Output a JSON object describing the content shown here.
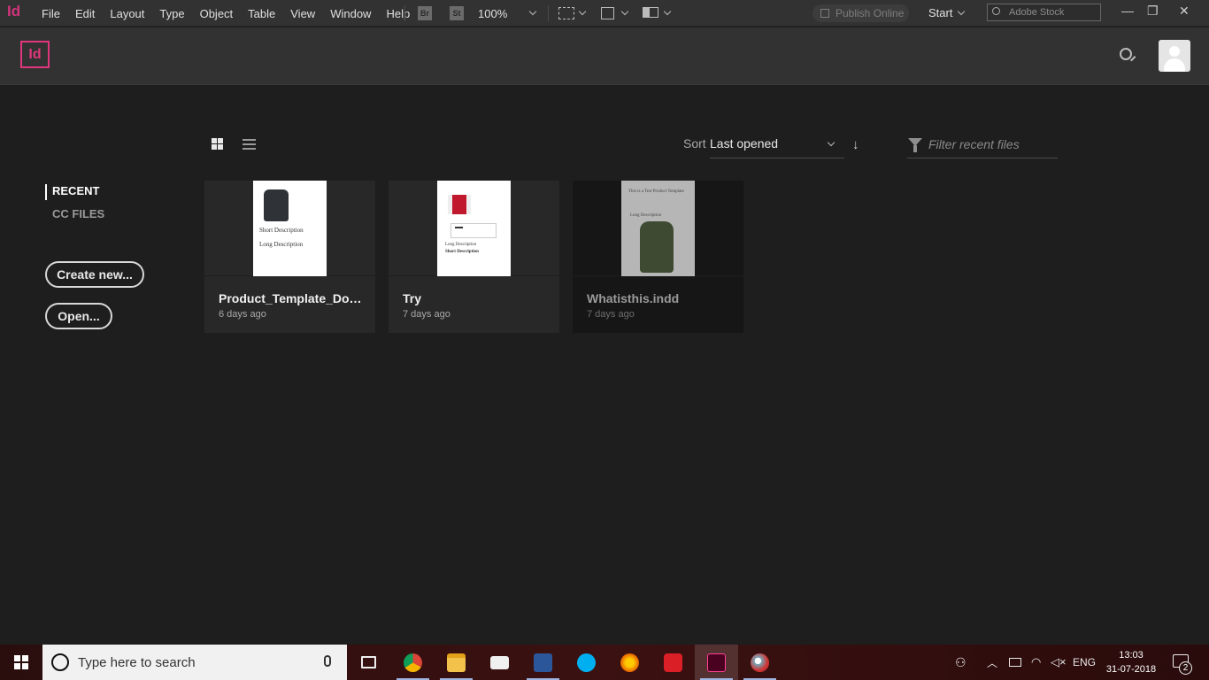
{
  "menubar": {
    "app_glyph": "Id",
    "menus": [
      "File",
      "Edit",
      "Layout",
      "Type",
      "Object",
      "Table",
      "View",
      "Window",
      "Help"
    ],
    "bridge": "Br",
    "stock_btn": "St",
    "zoom": "100%",
    "publish_online": "Publish Online",
    "workspace": "Start",
    "search_stock_placeholder": "Adobe Stock",
    "window_controls": [
      "—",
      "❐",
      "✕"
    ]
  },
  "header": {
    "logo_text": "Id"
  },
  "toolbar": {
    "sort_label": "Sort",
    "sort_value": "Last opened",
    "filter_placeholder": "Filter recent files"
  },
  "nav": {
    "recent": "RECENT",
    "cc_files": "CC FILES"
  },
  "buttons": {
    "create_new": "Create new...",
    "open": "Open..."
  },
  "recent_files": [
    {
      "title": "Product_Template_Docum...",
      "date": "6 days ago",
      "thumb_lines": [
        "Short Description",
        "Long Description"
      ]
    },
    {
      "title": "Try",
      "date": "7 days ago",
      "thumb_lines": [
        "Long Description",
        "Short Description"
      ]
    },
    {
      "title": "Whatisthis.indd",
      "date": "7 days ago",
      "thumb_lines": [
        "This is a Test Product Template",
        "Long Description"
      ]
    }
  ],
  "taskbar": {
    "search_placeholder": "Type here to search",
    "language": "ENG",
    "time": "13:03",
    "date": "31-07-2018",
    "notification_count": "2",
    "apps": [
      "task-view",
      "chrome",
      "file-explorer",
      "mail",
      "word",
      "skype",
      "firefox",
      "creative-cloud",
      "indesign",
      "paint"
    ]
  },
  "colors": {
    "indesign_pink": "#e0367b",
    "background": "#1e1e1e",
    "header": "#323232"
  }
}
